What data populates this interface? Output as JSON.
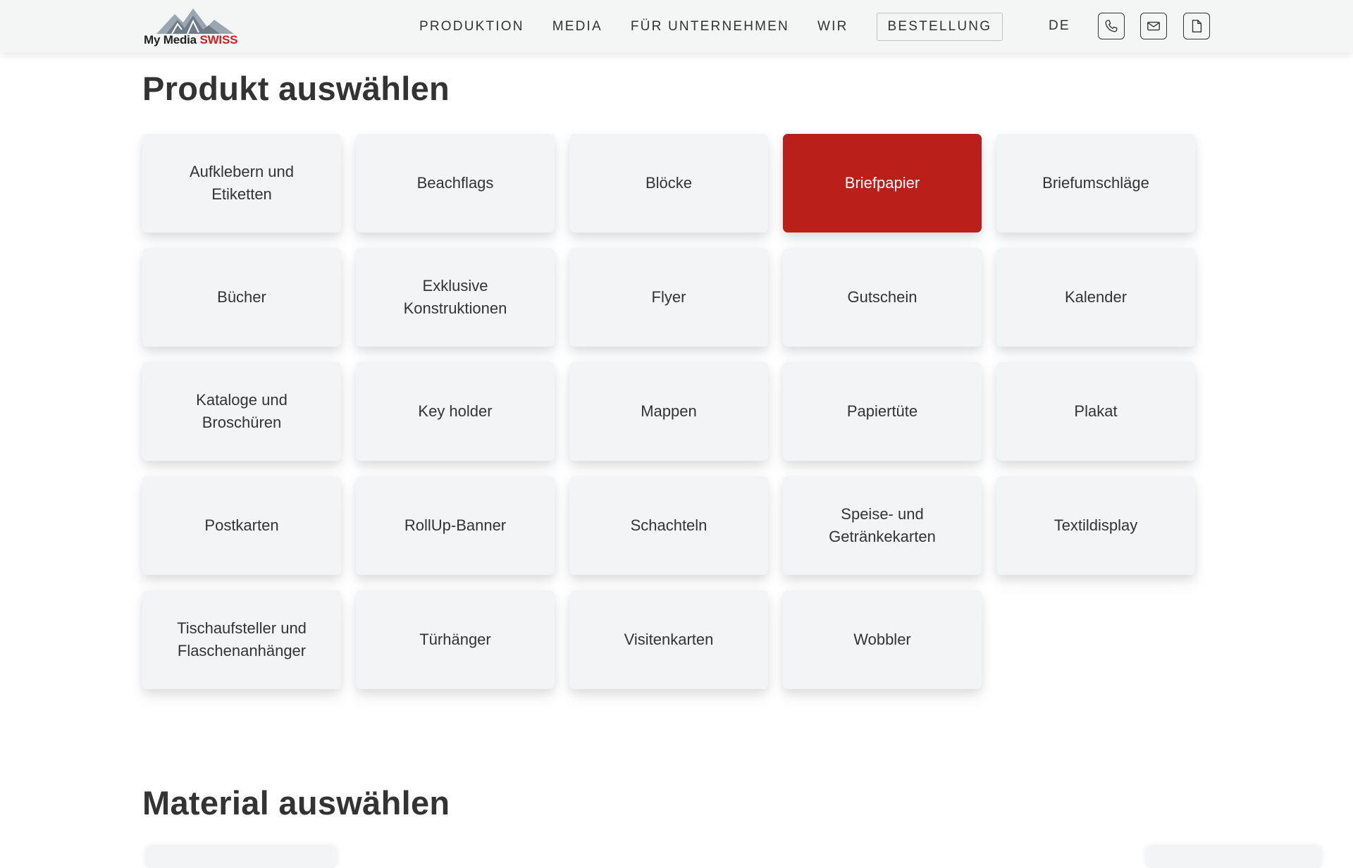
{
  "header": {
    "logo": {
      "name_prefix": "My Media ",
      "name_accent": "SWISS"
    },
    "nav": [
      "PRODUKTION",
      "MEDIA",
      "FÜR UNTERNEHMEN",
      "WIR",
      "BESTELLUNG"
    ],
    "language": "DE",
    "icons": [
      "phone-icon",
      "mail-icon",
      "document-icon"
    ]
  },
  "product_section": {
    "title": "Produkt auswählen",
    "selected_index": 3,
    "products": [
      "Aufklebern und Etiketten",
      "Beachflags",
      "Blöcke",
      "Briefpapier",
      "Briefumschläge",
      "Bücher",
      "Exklusive Konstruktionen",
      "Flyer",
      "Gutschein",
      "Kalender",
      "Kataloge und Broschüren",
      "Key holder",
      "Mappen",
      "Papiertüte",
      "Plakat",
      "Postkarten",
      "RollUp-Banner",
      "Schachteln",
      "Speise- und Getränkekarten",
      "Textildisplay",
      "Tischaufsteller und Flaschenanhänger",
      "Türhänger",
      "Visitenkarten",
      "Wobbler"
    ]
  },
  "material_section": {
    "title": "Material auswählen"
  },
  "colors": {
    "accent_red": "#bb1f1a",
    "card_bg": "#f3f4f5",
    "header_bg": "#f4f5f5",
    "logo_red": "#d21f1f"
  }
}
